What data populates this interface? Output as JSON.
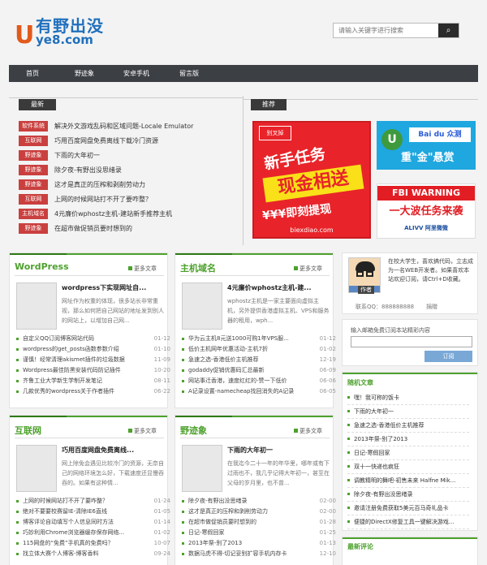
{
  "logo": {
    "mark": "U",
    "top": "有野出没",
    "bottom": "ye8.com"
  },
  "search": {
    "placeholder": "请输入关键字进行搜索",
    "button": "⌕"
  },
  "nav": [
    "首页",
    "野迹象",
    "安卓手机",
    "留言版"
  ],
  "latest": {
    "title": "最新",
    "items": [
      {
        "tag": "软件系统",
        "text": "解决外文游戏乱码和区域问题-Locale Emulator"
      },
      {
        "tag": "互联网",
        "text": "巧用百度网盘免费离线下载冷门资源"
      },
      {
        "tag": "野迹象",
        "text": "下雨的大年初一"
      },
      {
        "tag": "野迹象",
        "text": "除夕夜-有野出没思绪录"
      },
      {
        "tag": "野迹象",
        "text": "这才是真正的压榨和剥削劳动力"
      },
      {
        "tag": "互联网",
        "text": "上网的时候网站打不开了要咋整？"
      },
      {
        "tag": "主机域名",
        "text": "4元廉价wphostz主机-建站新手推荐主机"
      },
      {
        "tag": "野迹象",
        "text": "在超市做促销员要时想到的"
      }
    ]
  },
  "recommend": {
    "title": "推荐",
    "ad1": {
      "brand": "别叉掉",
      "l1": "新手任务",
      "l2": "现金相送",
      "l3": "¥¥¥即刻提现",
      "url": "biexdiao.com"
    },
    "ad2": {
      "brand": "Bai du 众测",
      "l1": "重\"金\"悬赏"
    },
    "ad3": {
      "l1": "FBI WARNING",
      "l2": "一大波任务来袭",
      "brand": "ALIVV 阿里微微"
    }
  },
  "profile": {
    "caption": "作者",
    "text": "在校大学生，喜欢搞代码，立志成为一名WEB开发者。如果喜欢本站欢迎订阅，请Ctrl+D收藏。",
    "qq": "联系QQ：888888888",
    "donate": "捐赠"
  },
  "subscribe": {
    "label": "输入邮箱免费订阅本站精彩内容",
    "button": "订阅"
  },
  "sections": [
    {
      "title": "WordPress",
      "more": "更多文章",
      "post": "wordpress下实现网址自...",
      "excerpt": "网址作为权重的体现，很多站长非常重视，那么如何把自己网站的地址发到别人的网站上，以增加自己网...",
      "items": [
        {
          "t": "自定义QQ订阅博客网站代码",
          "d": "01-12"
        },
        {
          "t": "wordpress的get_posts函数参数介绍",
          "d": "01-10"
        },
        {
          "t": "谨慎！经常清理akismet插件的垃圾数据",
          "d": "11-09"
        },
        {
          "t": "Wordpress最佳防黑安装代码防记插件",
          "d": "10-20"
        },
        {
          "t": "齐鲁工业大学新生学制开发笔记",
          "d": "08-11"
        },
        {
          "t": "几款优秀的wordpress关于作者插件",
          "d": "06-22"
        }
      ]
    },
    {
      "title": "主机域名",
      "more": "更多文章",
      "post": "4元廉价wphostz主机-建...",
      "excerpt": "wphostz主机是一家主要面向虚拟主机，另外提供香港虚拟主机、VPS和服务器的租用，wph...",
      "items": [
        {
          "t": "华为云主机8元送1000可购1年VPS服...",
          "d": "01-12"
        },
        {
          "t": "低价主机网年优惠活动-主机7折",
          "d": "01-02"
        },
        {
          "t": "急速之选-香港低价主机推荐",
          "d": "12-19"
        },
        {
          "t": "godaddy促销优惠码汇总最新",
          "d": "06-09"
        },
        {
          "t": "网站事迁香港，速度红红的-赞一下低价",
          "d": "06-06"
        },
        {
          "t": "A记录设置-namecheap找回消失的A记录",
          "d": "06-05"
        }
      ]
    },
    {
      "title": "互联网",
      "more": "更多文章",
      "post": "巧用百度网盘免费离线...",
      "excerpt": "网上除免会遇见比较冷门的资源，无奈自己的网络环境怎么好，下载速度还显慢吞吞的。如果有这种情...",
      "items": [
        {
          "t": "上网的时候网站打不开了要咋整？",
          "d": "01-24"
        },
        {
          "t": "绝对不要要校赛留IE-清除IE6直线",
          "d": "01-05"
        },
        {
          "t": "博客评论自动填写个人信息同时方法",
          "d": "01-14"
        },
        {
          "t": "巧妙利用Chrome浏览器缓存保存网络...",
          "d": "01-02"
        },
        {
          "t": "115网盘的“免费”手机真的免费吗？",
          "d": "10-07"
        },
        {
          "t": "找立体大赛个人博客-博客香料",
          "d": "09-24"
        }
      ]
    },
    {
      "title": "野迹象",
      "more": "更多文章",
      "post": "下雨的大年初一",
      "excerpt": "在我迄今二十一年的年华里，哪年或有下过雨也不，我几乎记得大年初一，甚至在父母的岁月里，也不曾...",
      "items": [
        {
          "t": "除夕夜-有野出没思绪录",
          "d": "02-00"
        },
        {
          "t": "这才是真正的压榨和剥削劳动力",
          "d": "02-00"
        },
        {
          "t": "在超市做促销员要时想到的",
          "d": "01-28"
        },
        {
          "t": "日记-寒假回家",
          "d": "01-25"
        },
        {
          "t": "2013年祭-别了2013",
          "d": "01-13"
        },
        {
          "t": "数据马虎不得-切记妥别扩容手机内存卡",
          "d": "12-10"
        }
      ]
    }
  ],
  "random": {
    "title": "随机文章",
    "items": [
      "嘿！我可称的饭卡",
      "下雨的大年初一",
      "急速之选-香港低价主机推荐",
      "2013年祭-别了2013",
      "日记-寒假回家",
      "双十一快递也疯狂",
      "调教精明的舞吧-初售未来 Halfne Mik...",
      "除夕夜-有野出没思绪录",
      "邀请注册免费获取5美元百马奇礼品卡",
      "便捷的DirectX修复工具一键解决游戏..."
    ]
  },
  "comments": {
    "title": "最新评论"
  }
}
